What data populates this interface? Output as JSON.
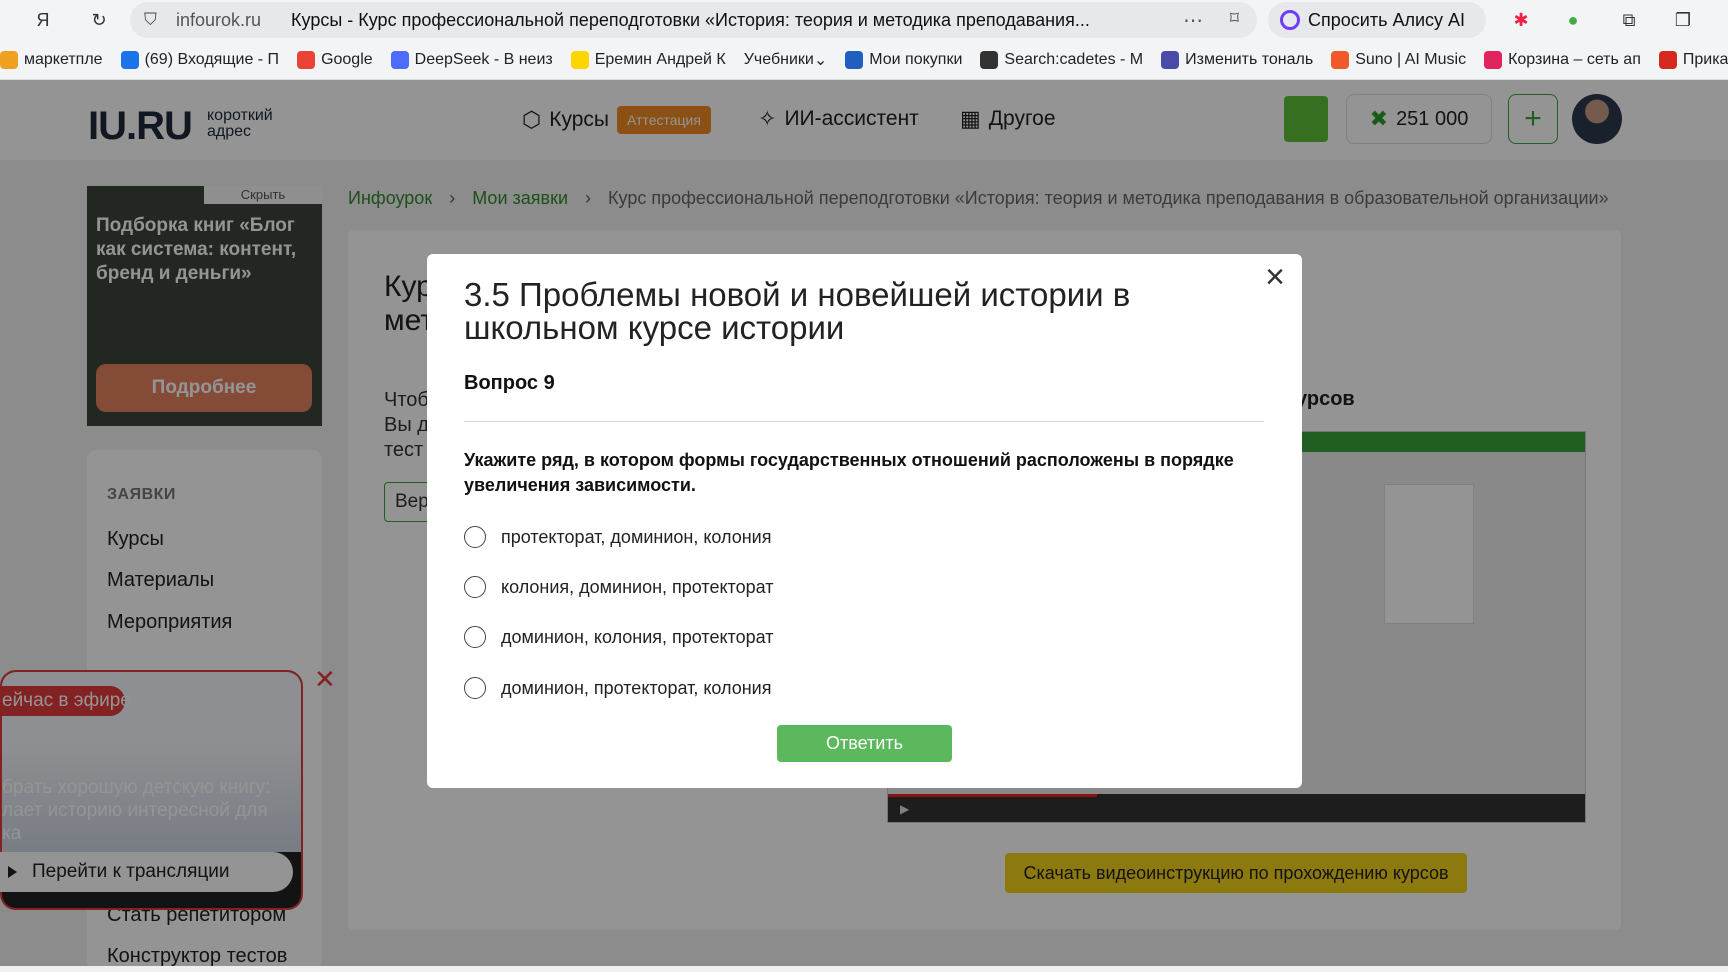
{
  "browser": {
    "domain": "infourok.ru",
    "tab_title": "Курсы - Курс профессиональной переподготовки «История: теория и методика преподавания...",
    "alice": "Спросить Алису AI"
  },
  "bookmarks": [
    {
      "label": "маркетпле",
      "color": "#f0a020"
    },
    {
      "label": "(69) Входящие - П",
      "color": "#1a73e8"
    },
    {
      "label": "Google",
      "color": "#ea4335"
    },
    {
      "label": "DeepSeek - В неиз",
      "color": "#4d6bfe"
    },
    {
      "label": "Еремин Андрей К",
      "color": "#ffd500"
    },
    {
      "label": "Учебники",
      "color": "#f3f4f6"
    },
    {
      "label": "Мои покупки",
      "color": "#1f5fbf"
    },
    {
      "label": "Search:cadetes - M",
      "color": "#333333"
    },
    {
      "label": "Изменить тональ",
      "color": "#4a4aa8"
    },
    {
      "label": "Suno | AI Music",
      "color": "#f05a28"
    },
    {
      "label": "Корзина – сеть ап",
      "color": "#e0245e"
    },
    {
      "label": "Прика",
      "color": "#d52b1e"
    }
  ],
  "header": {
    "logo": "IU.RU",
    "logo_sub_1": "короткий",
    "logo_sub_2": "адрес",
    "nav_courses": "Курсы",
    "nav_badge": "Аттестация",
    "nav_ai": "ИИ-ассистент",
    "nav_other": "Другое",
    "balance": "251 000"
  },
  "ad": {
    "hide": "Скрыть",
    "text": "Подборка книг «Блог как система: контент, бренд и деньги»",
    "button": "Подробнее"
  },
  "sidebar": {
    "heading": "ЗАЯВКИ",
    "items": [
      "Курсы",
      "Материалы",
      "Мероприятия"
    ],
    "below_items": [
      "Стать репетитором",
      "Конструктор тестов"
    ]
  },
  "breadcrumb": {
    "home": "Инфоурок",
    "requests": "Мои заявки",
    "current": "Курс профессиональной переподготовки «История: теория и методика преподавания в образовательной организации»"
  },
  "content": {
    "title_line1": "Кур",
    "title_line2": "мет",
    "text_line1": "Чтоб",
    "text_line2": "Вы д",
    "text_line3": "тест",
    "button": "Вер",
    "video_heading": "урсов",
    "download_button": "Скачать видеоинструкцию по прохождению курсов"
  },
  "live": {
    "badge": "ейчас в эфире",
    "caption": "брать хорошую детскую книгу: лает историю интересной для ка",
    "go": "Перейти к трансляции"
  },
  "modal": {
    "title": "3.5 Проблемы новой и новейшей истории в школьном курсе истории",
    "question_number": "Вопрос 9",
    "question_text": "Укажите ряд, в котором формы государственных отношений расположены в порядке увеличения зависимости.",
    "options": [
      "протекторат, доминион, колония",
      "колония, доминион, протекторат",
      "доминион, колония, протекторат",
      "доминион, протекторат, колония"
    ],
    "submit": "Ответить"
  }
}
